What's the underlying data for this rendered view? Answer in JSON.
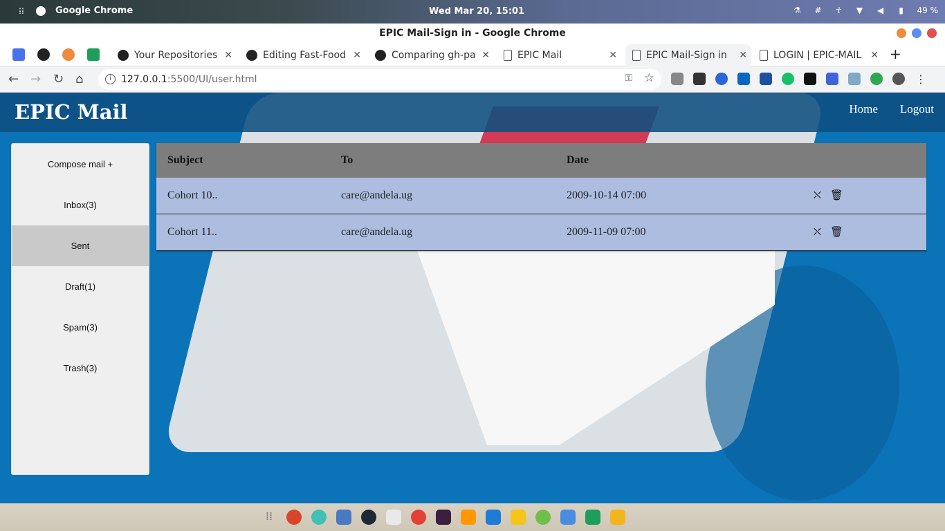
{
  "system_bar": {
    "app_name": "Google Chrome",
    "clock": "Wed Mar 20, 15:01",
    "battery": "49 %"
  },
  "window": {
    "title": "EPIC Mail-Sign in - Google Chrome"
  },
  "tabs": [
    {
      "label": "Your Repositories",
      "icon": "github-icon"
    },
    {
      "label": "Editing Fast-Food",
      "icon": "github-icon"
    },
    {
      "label": "Comparing gh-pa",
      "icon": "github-icon"
    },
    {
      "label": "EPIC Mail",
      "icon": "page-icon"
    },
    {
      "label": "EPIC Mail-Sign in",
      "icon": "page-icon",
      "active": true
    },
    {
      "label": "LOGIN | EPIC-MAIL",
      "icon": "page-icon"
    }
  ],
  "address_bar": {
    "url_host": "127.0.0.1",
    "url_path": ":5500/UI/user.html"
  },
  "page": {
    "brand": "EPIC Mail",
    "nav": {
      "home": "Home",
      "logout": "Logout"
    },
    "sidebar": [
      {
        "label": "Compose mail +"
      },
      {
        "label": "Inbox(3)"
      },
      {
        "label": "Sent",
        "active": true
      },
      {
        "label": "Draft(1)"
      },
      {
        "label": "Spam(3)"
      },
      {
        "label": "Trash(3)"
      }
    ],
    "table": {
      "headers": [
        "Subject",
        "To",
        "Date"
      ],
      "rows": [
        {
          "subject": "Cohort 10..",
          "to": "care@andela.ug",
          "date": "2009-10-14 07:00"
        },
        {
          "subject": "Cohort 11..",
          "to": "care@andela.ug",
          "date": "2009-11-09 07:00"
        }
      ]
    }
  },
  "colors": {
    "page_bg": "#0b73b8",
    "header_bg": "#0e4e80",
    "table_header": "#7d7d7d",
    "table_row": "#adbde0",
    "sidebar_bg": "#efefef",
    "sidebar_active": "#c9c9c9"
  }
}
